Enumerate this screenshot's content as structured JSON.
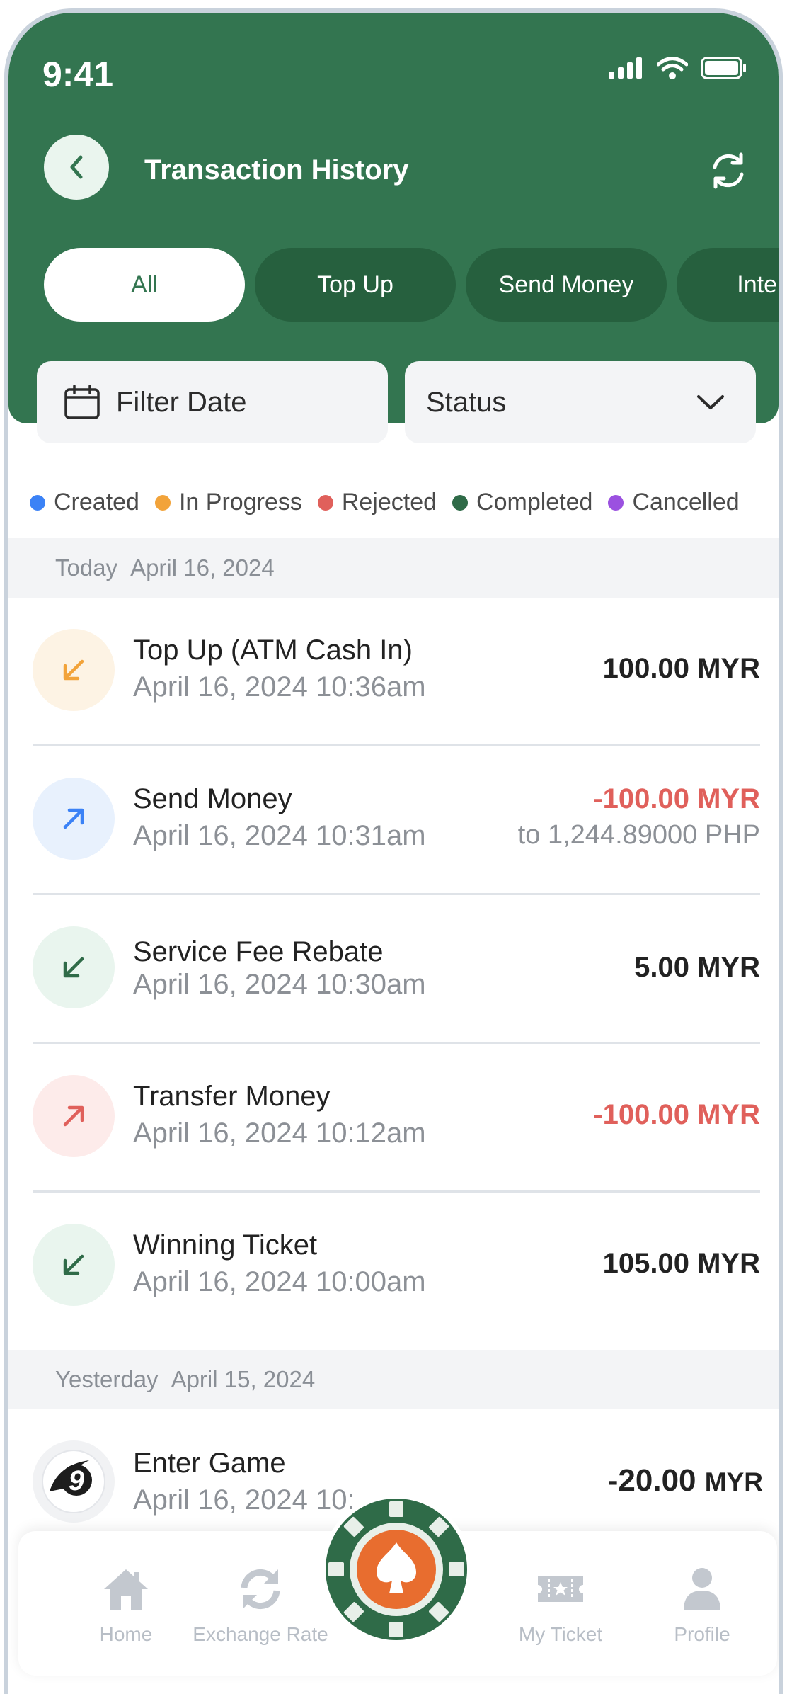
{
  "status_bar": {
    "time": "9:41"
  },
  "header": {
    "title": "Transaction History"
  },
  "tabs": [
    {
      "label": "All",
      "active": true
    },
    {
      "label": "Top Up",
      "active": false
    },
    {
      "label": "Send Money",
      "active": false
    },
    {
      "label": "Internal",
      "active": false
    }
  ],
  "filters": {
    "date_label": "Filter Date",
    "status_label": "Status"
  },
  "legend": [
    {
      "label": "Created",
      "color": "#3b82f6"
    },
    {
      "label": "In Progress",
      "color": "#f2a33a"
    },
    {
      "label": "Rejected",
      "color": "#e0605b"
    },
    {
      "label": "Completed",
      "color": "#2f6b48"
    },
    {
      "label": "Cancelled",
      "color": "#9b51e0"
    }
  ],
  "groups": [
    {
      "day": "Today",
      "date": "April 16, 2024",
      "transactions": [
        {
          "title": "Top Up (ATM Cash In)",
          "datetime": "April 16, 2024  10:36am",
          "amount": "100.00 MYR",
          "icon": "arrow-down-left-icon",
          "icon_color": "#f2a33a",
          "icon_bg": "#fdf3e4"
        },
        {
          "title": "Send Money",
          "datetime": "April 16, 2024  10:31am",
          "amount": "-100.00 MYR",
          "sub_amount": "to 1,244.89000 PHP",
          "icon": "arrow-up-right-icon",
          "icon_color": "#3b82f6",
          "icon_bg": "#e8f1fd"
        },
        {
          "title": "Service Fee Rebate",
          "datetime": "April 16, 2024  10:30am",
          "amount": "5.00 MYR",
          "icon": "arrow-down-left-icon",
          "icon_color": "#2f6b48",
          "icon_bg": "#e9f5ee"
        },
        {
          "title": "Transfer Money",
          "datetime": "April 16, 2024  10:12am",
          "amount": "-100.00 MYR",
          "icon": "arrow-up-right-icon",
          "icon_color": "#e0605b",
          "icon_bg": "#fdebea"
        },
        {
          "title": "Winning Ticket",
          "datetime": "April 16, 2024  10:00am",
          "amount": "105.00 MYR",
          "icon": "arrow-down-left-icon",
          "icon_color": "#2f6b48",
          "icon_bg": "#e9f5ee"
        }
      ]
    },
    {
      "day": "Yesterday",
      "date": "April 15, 2024",
      "transactions": [
        {
          "title": "Enter Game",
          "datetime": "April 16, 2024  10:",
          "amount_value": "-20.00",
          "amount_unit": "MYR",
          "icon": "game-9-logo-icon"
        }
      ]
    }
  ],
  "bottom_nav": [
    {
      "label": "Home",
      "icon": "home-icon"
    },
    {
      "label": "Exchange Rate",
      "icon": "exchange-icon"
    },
    {
      "label": "",
      "icon": "spade-chip-icon"
    },
    {
      "label": "My Ticket",
      "icon": "ticket-icon"
    },
    {
      "label": "Profile",
      "icon": "profile-icon"
    }
  ],
  "colors": {
    "brand_green": "#337550",
    "negative_red": "#e0605b"
  }
}
